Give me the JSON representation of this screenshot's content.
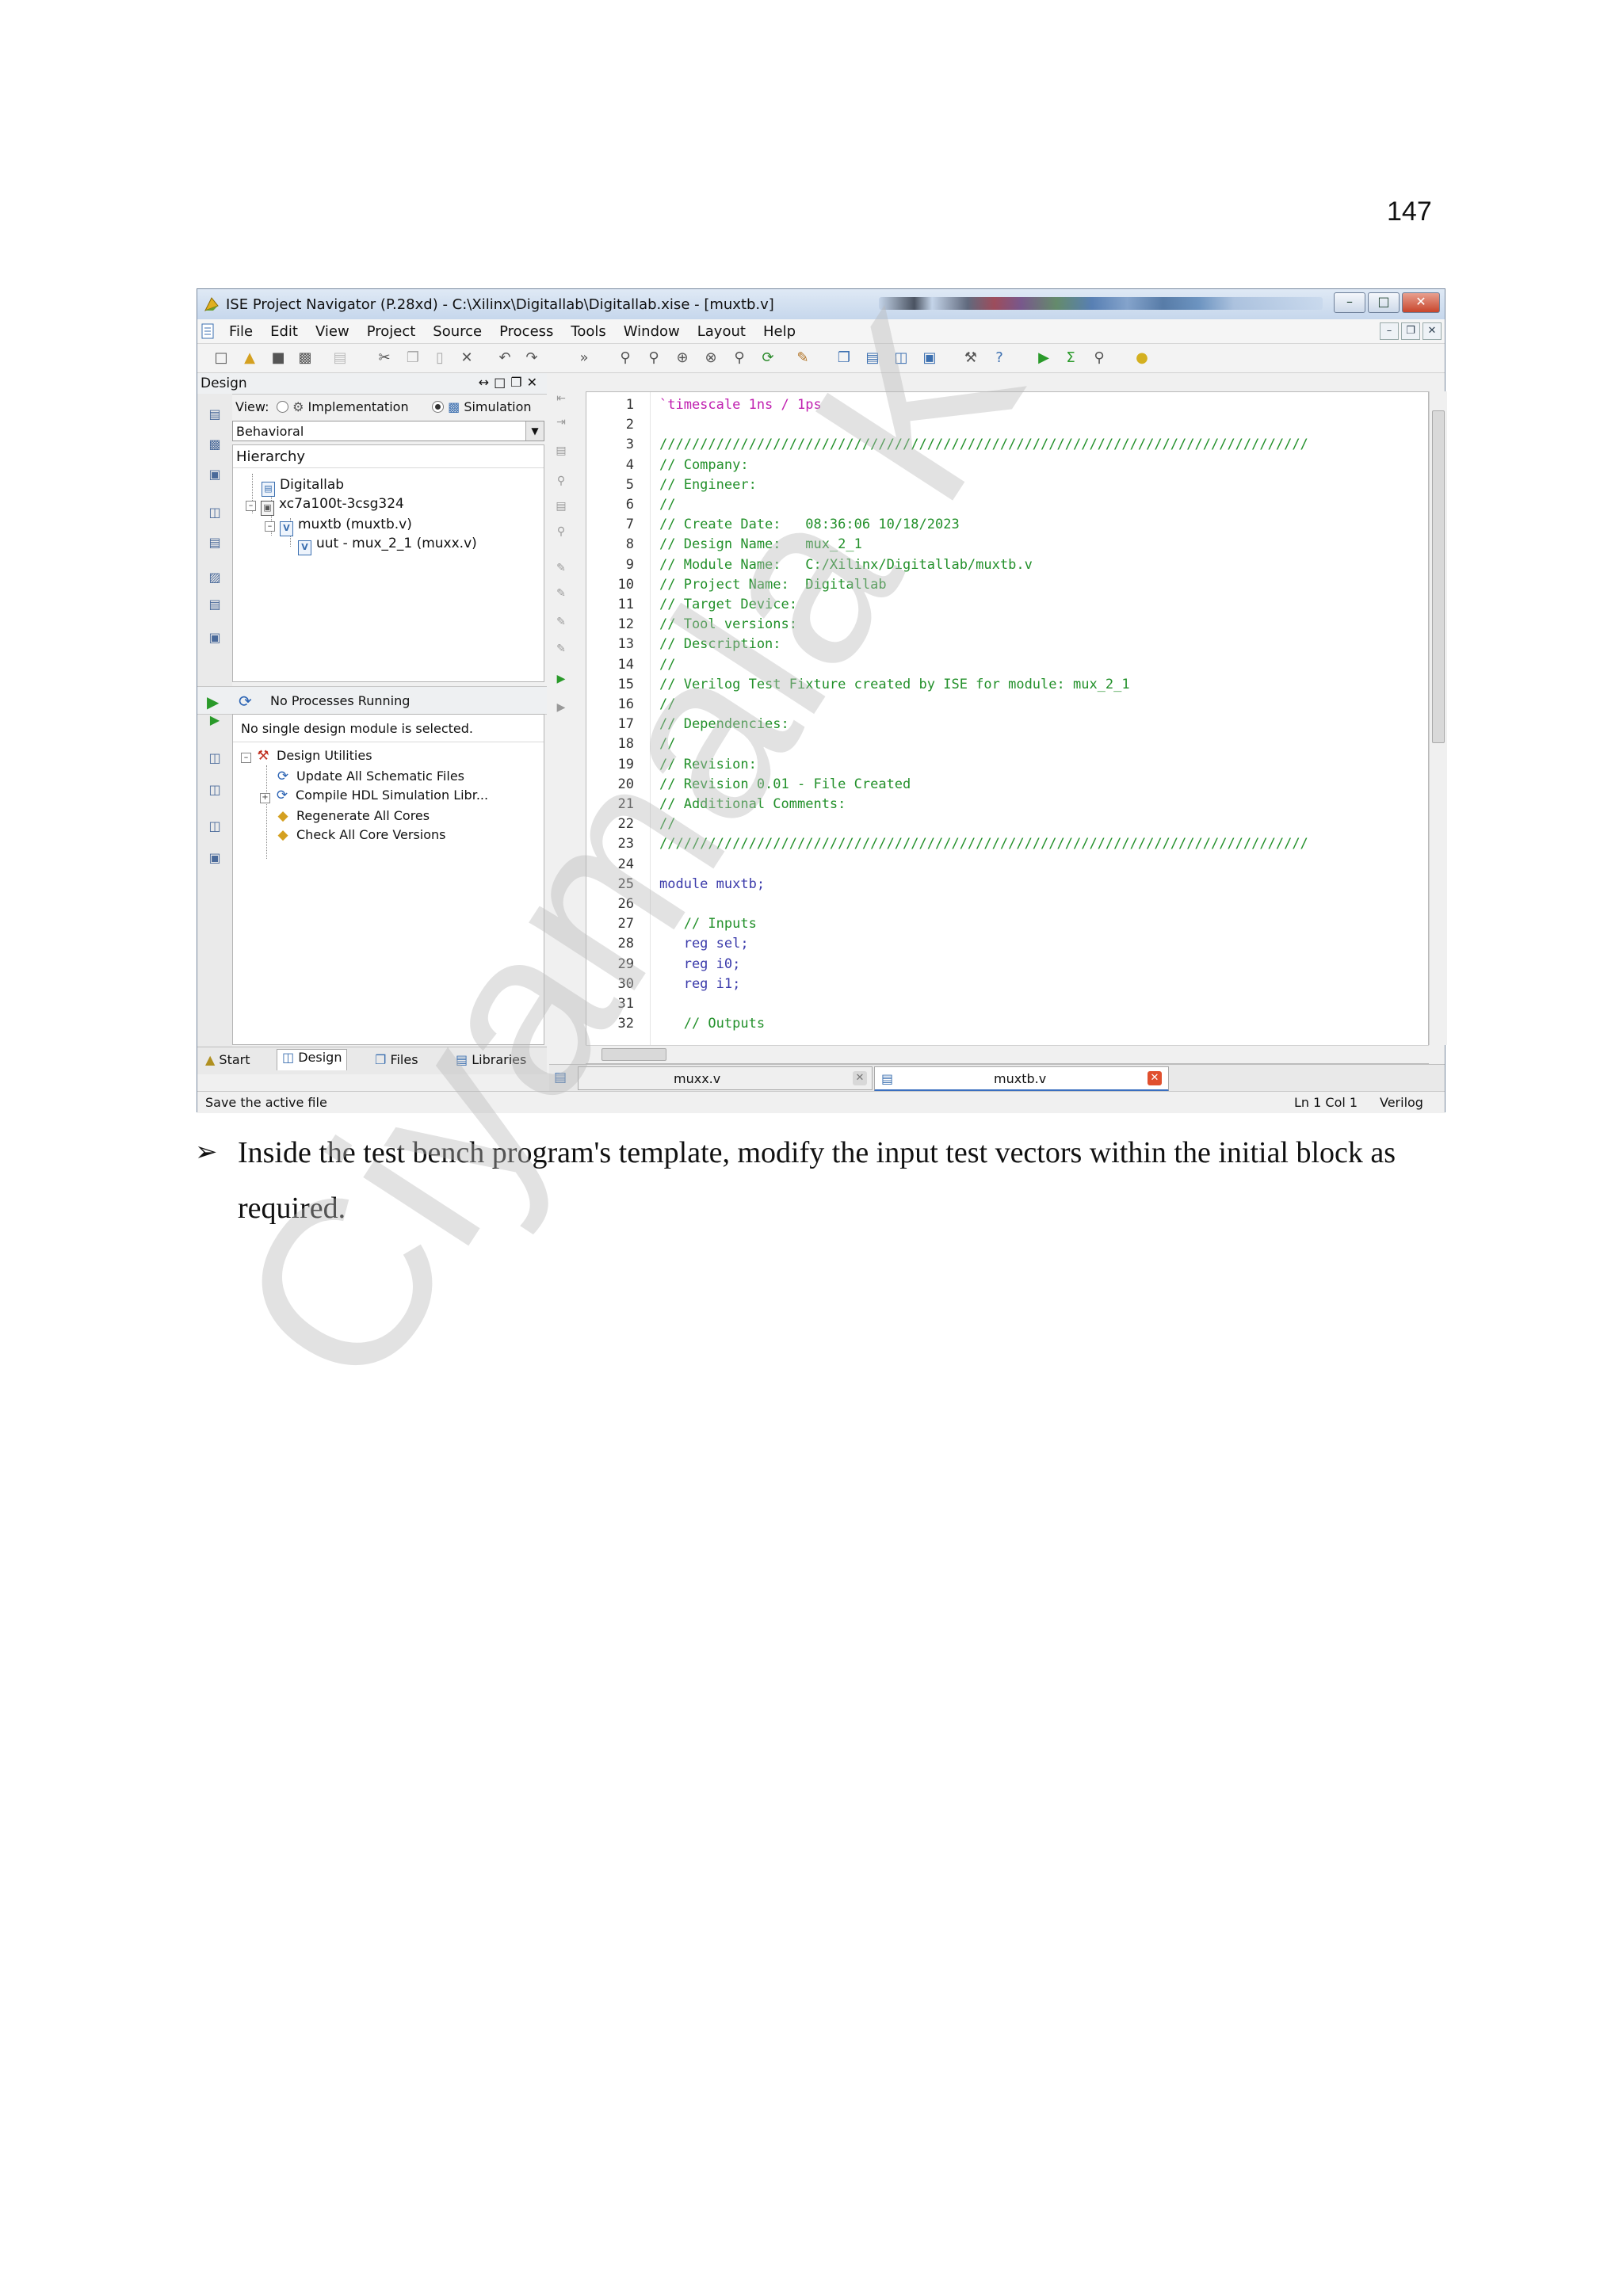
{
  "page_number": "147",
  "window": {
    "title": "ISE Project Navigator (P.28xd) - C:\\Xilinx\\Digitallab\\Digitallab.xise - [muxtb.v]",
    "menus": [
      "File",
      "Edit",
      "View",
      "Project",
      "Source",
      "Process",
      "Tools",
      "Window",
      "Layout",
      "Help"
    ]
  },
  "design_panel": {
    "title": "Design",
    "view_label": "View:",
    "view_options": [
      "Implementation",
      "Simulation"
    ],
    "view_selected": "Simulation",
    "combo_value": "Behavioral",
    "hierarchy_label": "Hierarchy",
    "tree": [
      "Digitallab",
      "xc7a100t-3csg324",
      "muxtb (muxtb.v)",
      "uut - mux_2_1 (muxx.v)"
    ]
  },
  "process_panel": {
    "status": "No Processes Running",
    "message": "No single design module is selected.",
    "group": "Design Utilities",
    "items": [
      "Update All Schematic Files",
      "Compile HDL Simulation Libr...",
      "Regenerate All Cores",
      "Check All Core Versions"
    ]
  },
  "left_tabs": [
    "Start",
    "Design",
    "Files",
    "Libraries"
  ],
  "code": [
    {
      "n": "1",
      "t": "`timescale 1ns / 1ps",
      "k": "dir"
    },
    {
      "n": "2",
      "t": "",
      "k": "plain"
    },
    {
      "n": "3",
      "t": "////////////////////////////////////////////////////////////////////////////////",
      "k": "comment"
    },
    {
      "n": "4",
      "t": "// Company:",
      "k": "comment"
    },
    {
      "n": "5",
      "t": "// Engineer:",
      "k": "comment"
    },
    {
      "n": "6",
      "t": "//",
      "k": "comment"
    },
    {
      "n": "7",
      "t": "// Create Date:   08:36:06 10/18/2023",
      "k": "comment"
    },
    {
      "n": "8",
      "t": "// Design Name:   mux_2_1",
      "k": "comment"
    },
    {
      "n": "9",
      "t": "// Module Name:   C:/Xilinx/Digitallab/muxtb.v",
      "k": "comment"
    },
    {
      "n": "10",
      "t": "// Project Name:  Digitallab",
      "k": "comment"
    },
    {
      "n": "11",
      "t": "// Target Device:",
      "k": "comment"
    },
    {
      "n": "12",
      "t": "// Tool versions:",
      "k": "comment"
    },
    {
      "n": "13",
      "t": "// Description:",
      "k": "comment"
    },
    {
      "n": "14",
      "t": "//",
      "k": "comment"
    },
    {
      "n": "15",
      "t": "// Verilog Test Fixture created by ISE for module: mux_2_1",
      "k": "comment"
    },
    {
      "n": "16",
      "t": "//",
      "k": "comment"
    },
    {
      "n": "17",
      "t": "// Dependencies:",
      "k": "comment"
    },
    {
      "n": "18",
      "t": "//",
      "k": "comment"
    },
    {
      "n": "19",
      "t": "// Revision:",
      "k": "comment"
    },
    {
      "n": "20",
      "t": "// Revision 0.01 - File Created",
      "k": "comment"
    },
    {
      "n": "21",
      "t": "// Additional Comments:",
      "k": "comment"
    },
    {
      "n": "22",
      "t": "//",
      "k": "comment"
    },
    {
      "n": "23",
      "t": "////////////////////////////////////////////////////////////////////////////////",
      "k": "comment"
    },
    {
      "n": "24",
      "t": "",
      "k": "plain"
    },
    {
      "n": "25",
      "t": "module muxtb;",
      "k": "kw"
    },
    {
      "n": "26",
      "t": "",
      "k": "plain"
    },
    {
      "n": "27",
      "t": "   // Inputs",
      "k": "comment"
    },
    {
      "n": "28",
      "t": "   reg sel;",
      "k": "kw"
    },
    {
      "n": "29",
      "t": "   reg i0;",
      "k": "kw"
    },
    {
      "n": "30",
      "t": "   reg i1;",
      "k": "kw"
    },
    {
      "n": "31",
      "t": "",
      "k": "plain"
    },
    {
      "n": "32",
      "t": "   // Outputs",
      "k": "comment"
    }
  ],
  "editor_tabs": [
    "muxx.v",
    "muxtb.v"
  ],
  "editor_active_tab": "muxtb.v",
  "status": {
    "left": "Save the active file",
    "position": "Ln 1 Col 1",
    "language": "Verilog"
  },
  "paragraph": "Inside the test bench program's template, modify the input test vectors within the initial block as required.",
  "watermark": "Ciyamala K",
  "colors": {
    "comment": "#22902a",
    "keyword": "#3a3aaa",
    "directive": "#c020b0",
    "titlebar": "#c6d7ec"
  }
}
